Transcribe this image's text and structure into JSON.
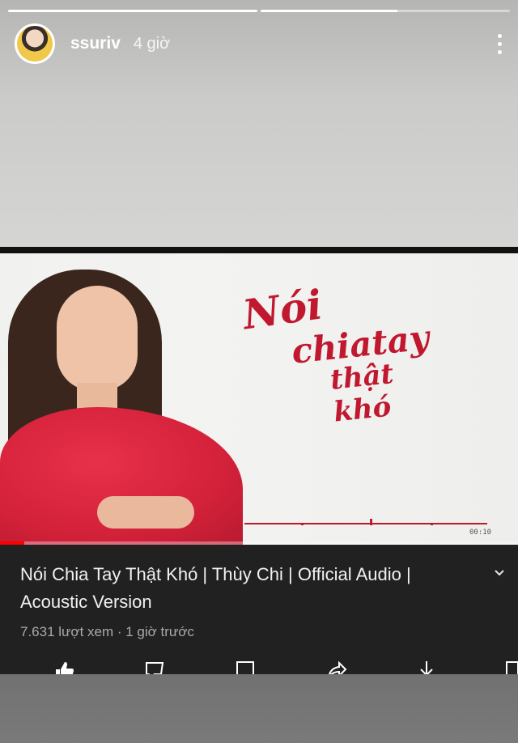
{
  "story": {
    "username": "ssuriv",
    "time": "4 giờ",
    "progress_segments": [
      1.0,
      0.55
    ],
    "more_icon": "more-vertical-icon"
  },
  "video": {
    "artwork_title_lines": [
      "Nói",
      "chiatay",
      "thật khó"
    ],
    "timestamp": "00:10",
    "accent_color": "#c0182f",
    "progress_color": "#ff0000"
  },
  "info": {
    "title": "Nói Chia Tay Thật Khó | Thùy Chi | Official Audio | Acoustic Version",
    "meta": "7.631 lượt xem · 1 giờ trước",
    "expand_icon": "chevron-down-icon",
    "actions": [
      "like-icon",
      "dislike-icon",
      "save-icon",
      "share-icon",
      "download-icon",
      "clip-icon"
    ]
  }
}
